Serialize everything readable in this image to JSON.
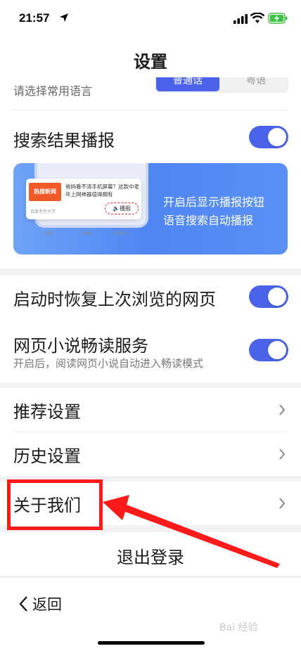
{
  "status": {
    "time": "21:57"
  },
  "nav": {
    "title": "设置"
  },
  "language": {
    "description": "请选择常用语言",
    "options": [
      "普通话",
      "粤语"
    ]
  },
  "search_broadcast": {
    "label": "搜索结果播报",
    "toggle_on": true,
    "promo": {
      "notif_tag": "热搜新闻",
      "notif_text": "爸妈看不清手机屏幕？这款中老年上网神器值得拥有",
      "notif_source": "百度老年大学",
      "play_label": "播报",
      "tabs": [
        "返回",
        "收藏",
        "网页页"
      ],
      "line1": "开启后显示播报按钮",
      "line2": "语音搜索自动播报"
    }
  },
  "restore": {
    "label": "启动时恢复上次浏览的网页",
    "toggle_on": true
  },
  "novel": {
    "label": "网页小说畅读服务",
    "sub": "开启后，阅读网页小说自动进入畅读模式",
    "toggle_on": true
  },
  "recommend": {
    "label": "推荐设置"
  },
  "history": {
    "label": "历史设置"
  },
  "about": {
    "label": "关于我们"
  },
  "logout": {
    "label": "退出登录"
  },
  "bottom": {
    "back_label": "返回",
    "watermark": "Bai 经验"
  },
  "colors": {
    "accent": "#4b63e9",
    "highlight": "#ff1a1a"
  }
}
